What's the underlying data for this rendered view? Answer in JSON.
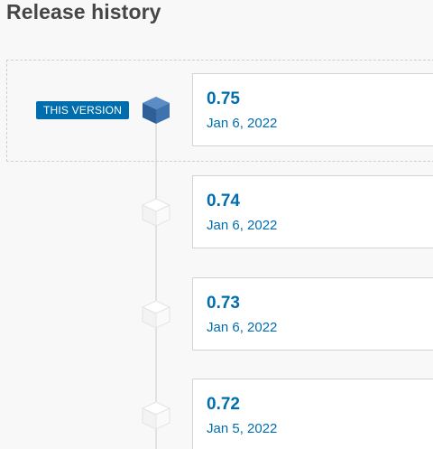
{
  "page": {
    "title": "Release history",
    "current_badge": "THIS VERSION"
  },
  "releases": [
    {
      "version": "0.75",
      "date": "Jan 6, 2022",
      "current": true
    },
    {
      "version": "0.74",
      "date": "Jan 6, 2022",
      "current": false
    },
    {
      "version": "0.73",
      "date": "Jan 6, 2022",
      "current": false
    },
    {
      "version": "0.72",
      "date": "Jan 5, 2022",
      "current": false
    }
  ],
  "icons": {
    "current": "package-icon-blue",
    "other": "package-icon-white"
  },
  "colors": {
    "accent": "#006dad",
    "icon_current": "#3a6ea5",
    "text_heading": "#464646"
  }
}
